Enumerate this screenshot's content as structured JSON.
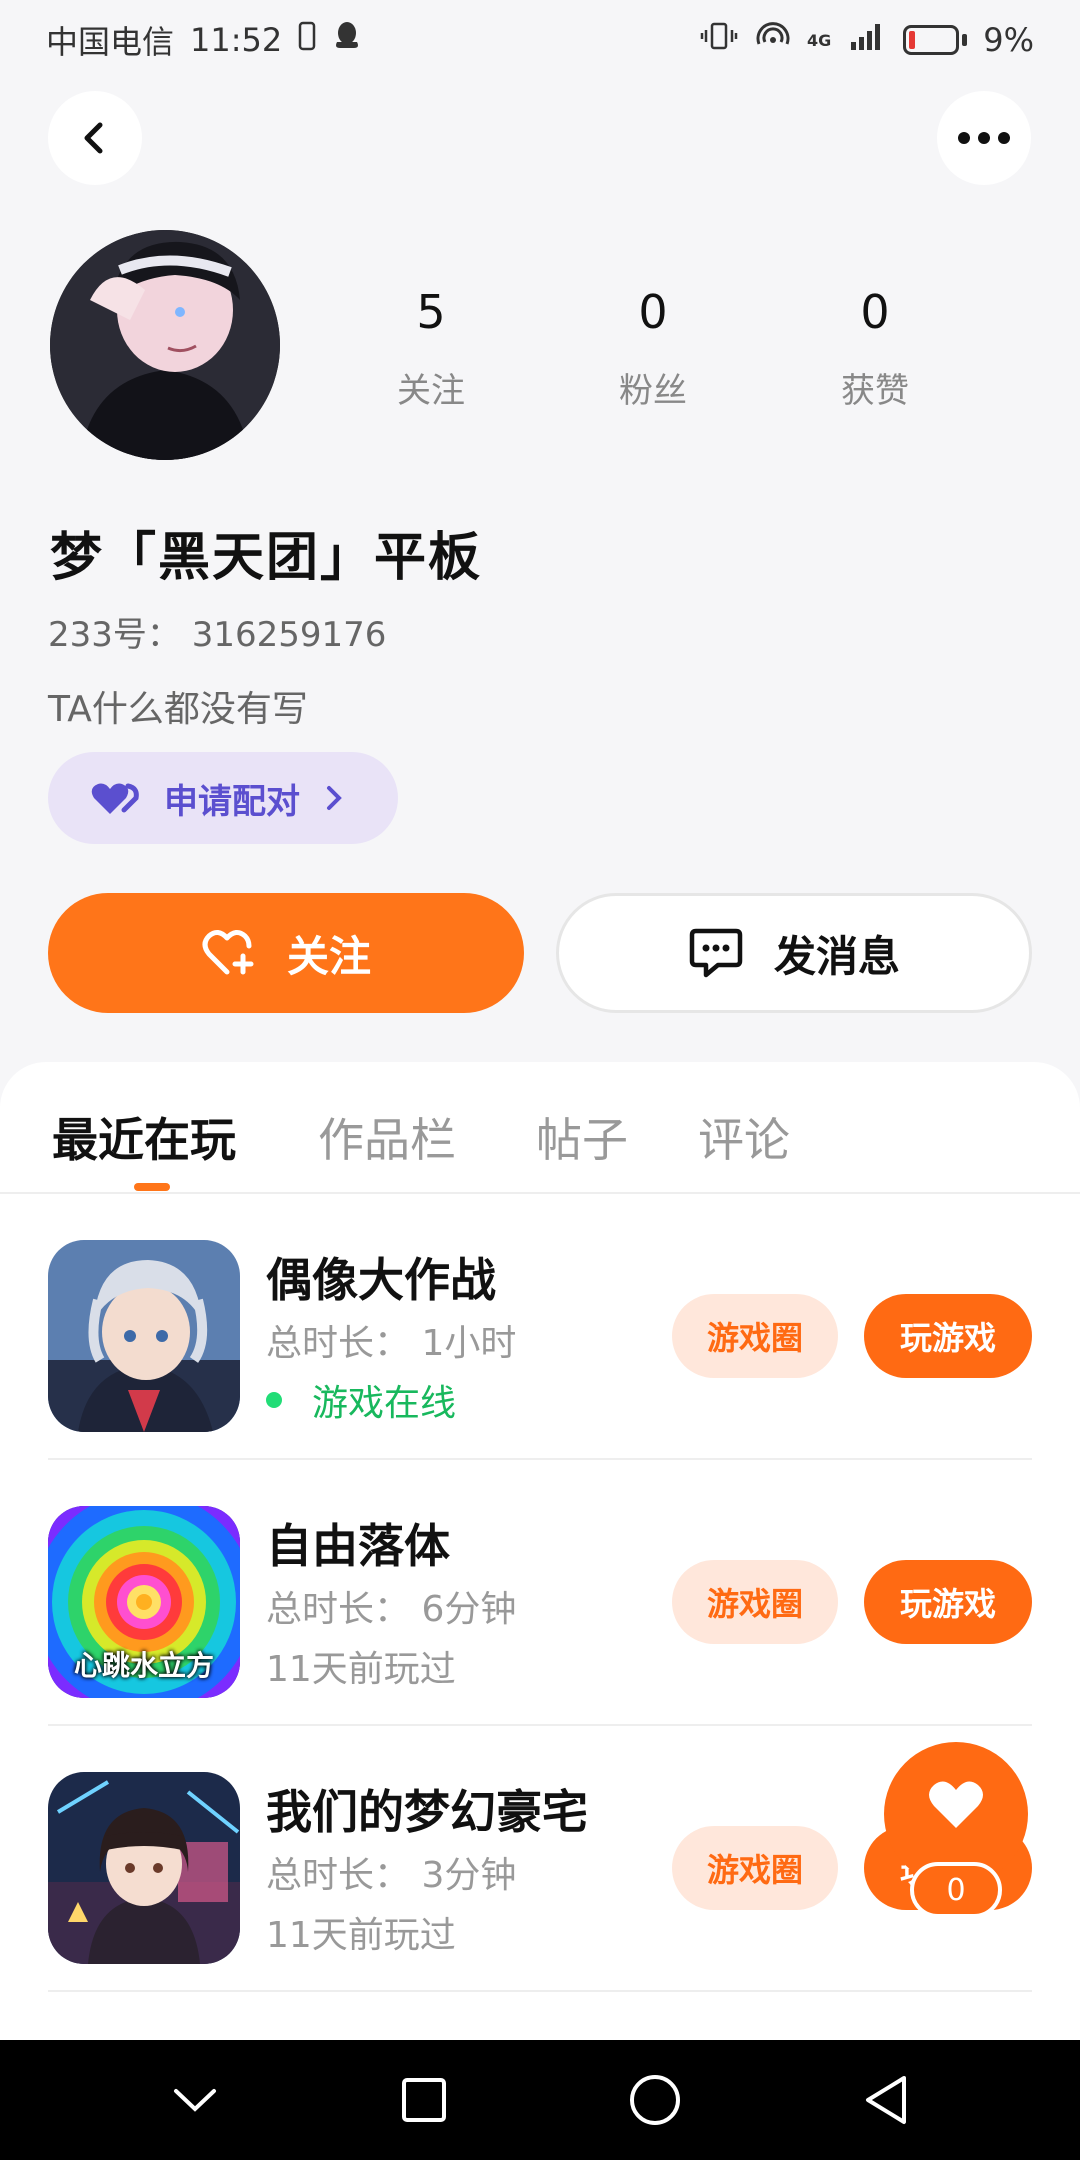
{
  "status_bar": {
    "carrier": "中国电信",
    "time": "11:52",
    "network": "4G",
    "battery": "9%"
  },
  "profile": {
    "stats": [
      {
        "value": "5",
        "label": "关注"
      },
      {
        "value": "0",
        "label": "粉丝"
      },
      {
        "value": "0",
        "label": "获赞"
      }
    ],
    "nickname": "梦「黑天团」平板",
    "uid": "233号： 316259176",
    "bio": "TA什么都没有写",
    "pair_label": "申请配对"
  },
  "actions": {
    "follow_label": "关注",
    "message_label": "发消息"
  },
  "tabs": [
    "最近在玩",
    "作品栏",
    "帖子",
    "评论"
  ],
  "games": [
    {
      "title": "偶像大作战",
      "time": "总时长： 1小时",
      "status": "游戏在线",
      "online": true
    },
    {
      "title": "自由落体",
      "time": "总时长： 6分钟",
      "status": "11天前玩过",
      "online": false,
      "icon_text": "心跳水立方"
    },
    {
      "title": "我们的梦幻豪宅",
      "time": "总时长： 3分钟",
      "status": "11天前玩过",
      "online": false
    }
  ],
  "game_buttons": {
    "circle": "游戏圈",
    "play": "玩游戏"
  },
  "float_like": {
    "count": "0"
  },
  "colors": {
    "accent": "#ff7519",
    "pair_purple": "#5b4fcf",
    "online_green": "#18b85d"
  }
}
